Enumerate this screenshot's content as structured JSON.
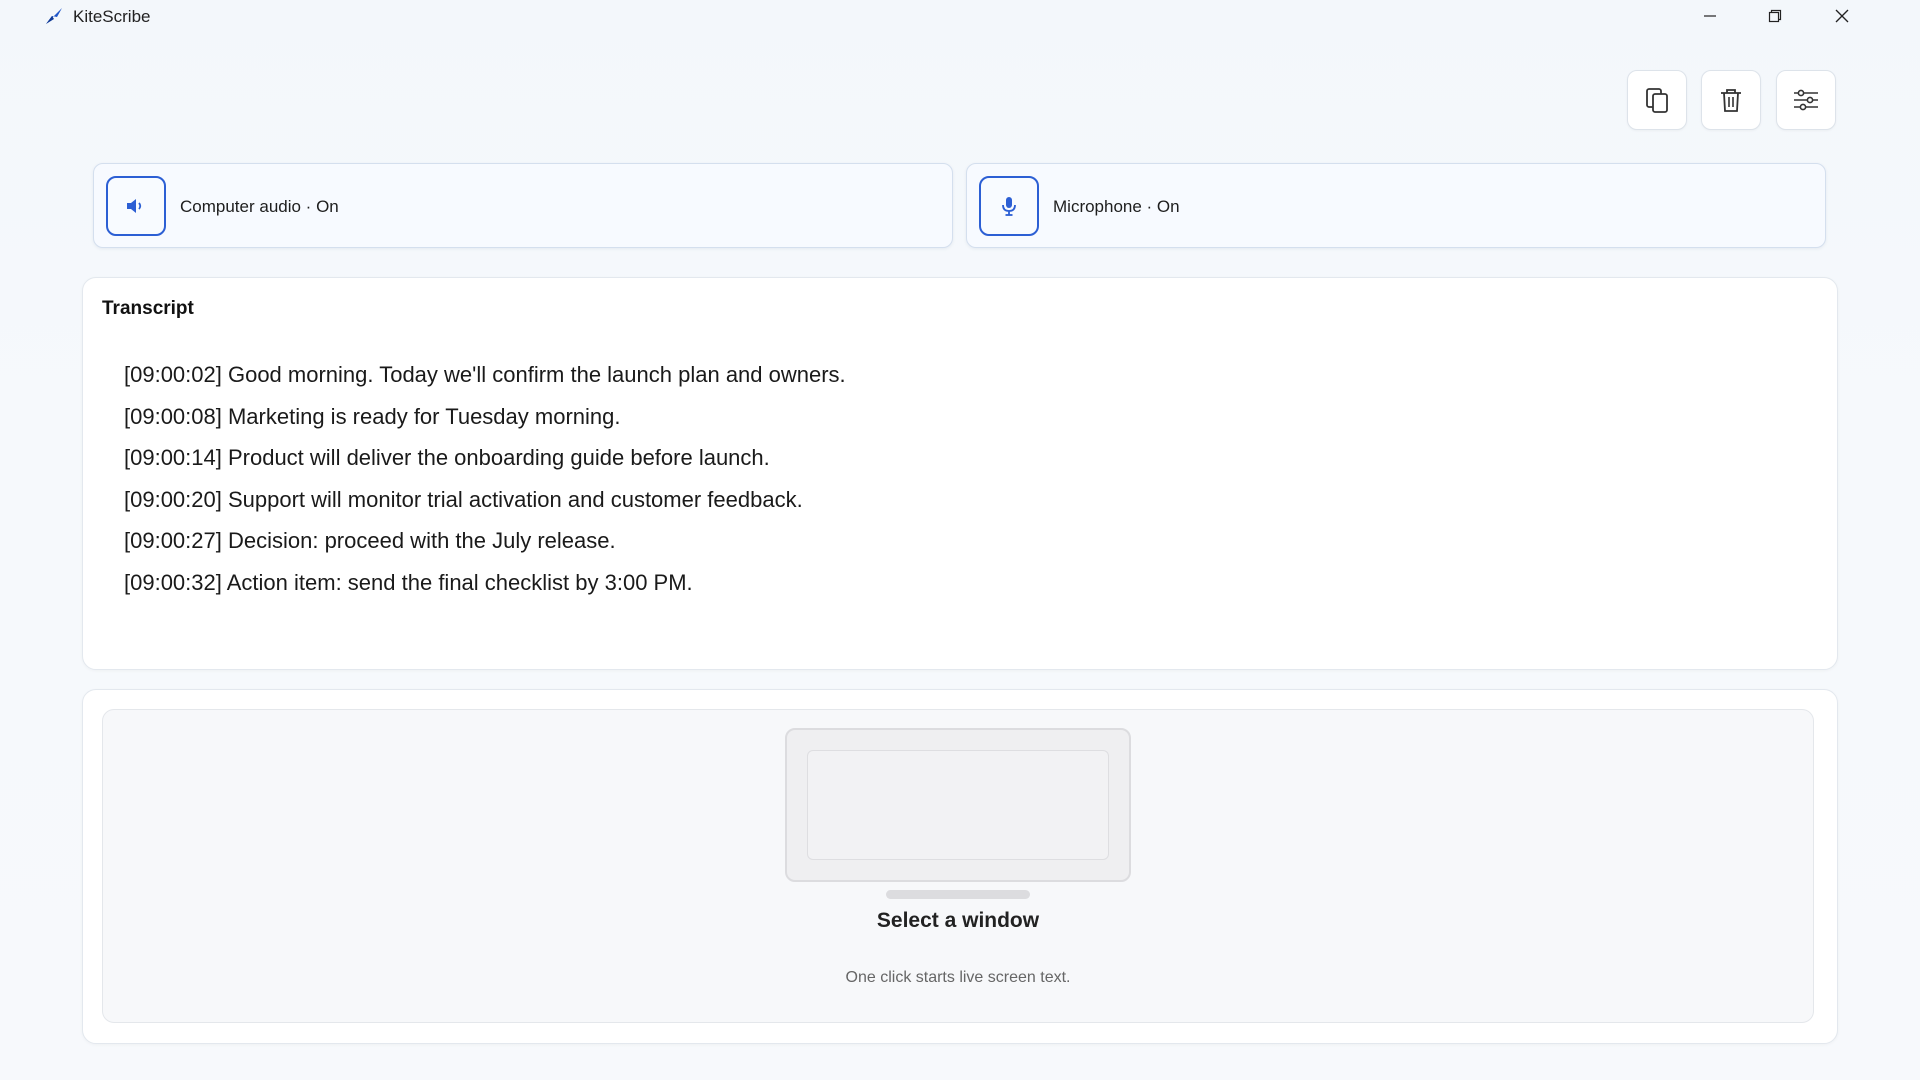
{
  "window": {
    "title": "KiteScribe",
    "controls": [
      "minimize-icon",
      "restore-icon",
      "close-icon"
    ]
  },
  "toolbar": {
    "buttons": [
      {
        "icon": "copy-icon"
      },
      {
        "icon": "trash-icon"
      },
      {
        "icon": "settings-sliders-icon"
      }
    ]
  },
  "sources": [
    {
      "icon": "speaker-icon",
      "label": "Computer audio · On"
    },
    {
      "icon": "microphone-icon",
      "label": "Microphone · On"
    }
  ],
  "transcript": {
    "title": "Transcript",
    "lines": [
      "[09:00:02] Good morning. Today we'll confirm the launch plan and owners.",
      "[09:00:08] Marketing is ready for Tuesday morning.",
      "[09:00:14] Product will deliver the onboarding guide before launch.",
      "[09:00:20] Support will monitor trial activation and customer feedback.",
      "[09:00:27] Decision: proceed with the July release.",
      "[09:00:32] Action item: send the final checklist by 3:00 PM."
    ]
  },
  "capture": {
    "title": "Select a window",
    "subtitle": "One click starts live screen text."
  },
  "colors": {
    "accent": "#2c5fd4",
    "background": "#f5f8fc",
    "panel": "#ffffff"
  }
}
